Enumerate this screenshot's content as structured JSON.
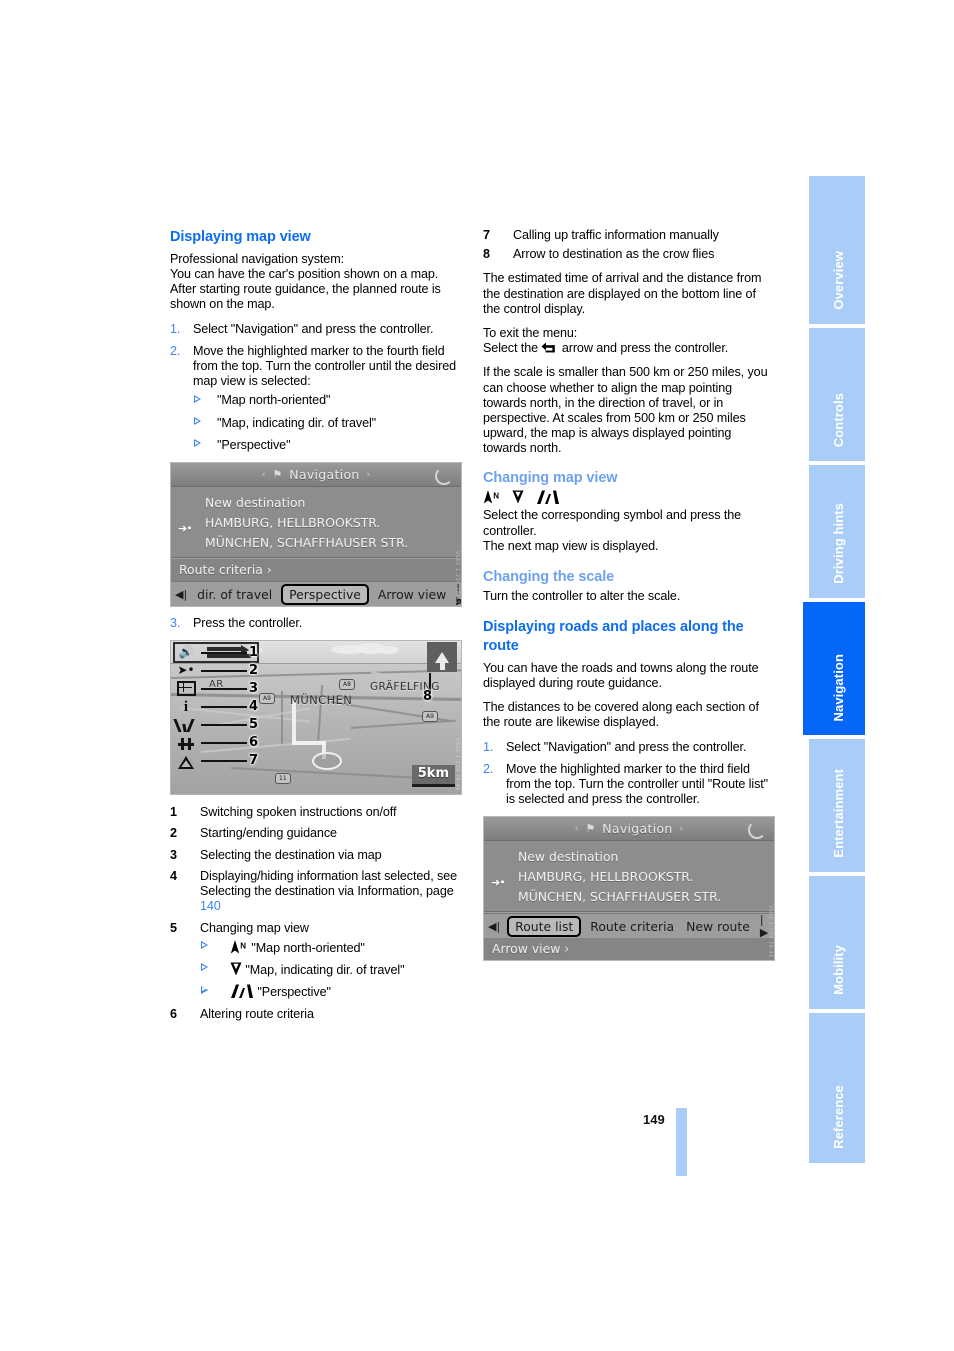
{
  "page": {
    "number": "149",
    "tabs": [
      {
        "label": "Overview",
        "active": false
      },
      {
        "label": "Controls",
        "active": false
      },
      {
        "label": "Driving hints",
        "active": false
      },
      {
        "label": "Navigation",
        "active": true
      },
      {
        "label": "Entertainment",
        "active": false
      },
      {
        "label": "Mobility",
        "active": false
      },
      {
        "label": "Reference",
        "active": false
      }
    ],
    "colors": {
      "heading_blue": "#0d6df0",
      "subheading_blue": "#6ea2ee",
      "tab_inactive": "#aacdf7",
      "tab_active": "#0566fa",
      "number_blue": "#3b86ef"
    }
  },
  "left": {
    "heading": "Displaying map view",
    "intro_line1": "Professional navigation system:",
    "intro_line2": "You can have the car's position shown on a map. After starting route guidance, the planned route is shown on the map.",
    "steps": [
      {
        "num": "1.",
        "text": "Select \"Navigation\" and press the controller."
      },
      {
        "num": "2.",
        "text": "Move the highlighted marker to the fourth field from the top. Turn the controller until the desired map view is selected:"
      }
    ],
    "map_view_options": [
      "\"Map north-oriented\"",
      "\"Map, indicating dir. of travel\"",
      "\"Perspective\""
    ],
    "step3": {
      "num": "3.",
      "text": "Press the controller."
    },
    "screenshot_nav": {
      "title": "Navigation",
      "title_left_arrow": "‹",
      "title_right_arrow": "›",
      "car_icon": "car-icon",
      "spinner_icon": "loading-spinner-icon",
      "rows": [
        {
          "label": "New destination",
          "marker": ""
        },
        {
          "label": "HAMBURG, HELLBROOKSTR.",
          "marker": "➜•"
        },
        {
          "label": "MÜNCHEN, SCHAFFHAUSER STR.",
          "marker": ""
        }
      ],
      "row_route_criteria": "Route criteria ›",
      "footer": {
        "left_arrow": "◀|",
        "left_item": "dir. of travel",
        "selected_item": "Perspective",
        "right_item": "Arrow view",
        "right_arrow": "|▶"
      }
    },
    "screenshot_map": {
      "icons": [
        {
          "n": "1",
          "name": "speaker-icon"
        },
        {
          "n": "2",
          "name": "guidance-arrow-icon"
        },
        {
          "n": "3",
          "name": "map-grid-icon"
        },
        {
          "n": "4",
          "name": "information-icon"
        },
        {
          "n": "5",
          "name": "map-view-icon"
        },
        {
          "n": "6",
          "name": "route-criteria-icon"
        },
        {
          "n": "7",
          "name": "traffic-warning-icon"
        }
      ],
      "callout_8": "8",
      "labels": [
        "MÜNCHEN",
        "GRÄFELFING"
      ],
      "scale": "5km"
    },
    "legend": [
      {
        "num": "1",
        "text": "Switching spoken instructions on/off"
      },
      {
        "num": "2",
        "text": "Starting/ending guidance"
      },
      {
        "num": "3",
        "text": "Selecting the destination via map"
      },
      {
        "num": "4",
        "text": "Displaying/hiding information last selected, see Selecting the destination via Information, page ",
        "page_ref": "140"
      },
      {
        "num": "5",
        "text": "Changing map view"
      },
      {
        "num": "6",
        "text": "Altering route criteria"
      }
    ],
    "legend5_options": [
      {
        "symbol": "map-north-oriented-icon",
        "text": "\"Map north-oriented\""
      },
      {
        "symbol": "map-direction-of-travel-icon",
        "text": "\"Map, indicating dir. of travel\""
      },
      {
        "symbol": "map-perspective-icon",
        "text": "\"Perspective\""
      }
    ]
  },
  "right": {
    "legend": [
      {
        "num": "7",
        "text": "Calling up traffic information manually"
      },
      {
        "num": "8",
        "text": "Arrow to destination as the crow flies"
      }
    ],
    "para_eta": "The estimated time of arrival and the distance from the destination are displayed on the bottom line of the control display.",
    "exit_line1": "To exit the menu:",
    "exit_line2_pre": "Select the ",
    "exit_line2_post": " arrow and press the controller.",
    "exit_icon": "back-arrow-icon",
    "para_scale": "If the scale is smaller than 500 km or 250 miles, you can choose whether to align the map pointing towards north, in the direction of travel, or in perspective. At scales from 500 km or 250 miles upward, the map is always displayed pointing towards north.",
    "changing_map_view": {
      "heading": "Changing map view",
      "symbols": [
        "map-north-oriented-icon",
        "map-direction-of-travel-icon",
        "map-perspective-icon"
      ],
      "line1": "Select the corresponding symbol and press the controller.",
      "line2": "The next map view is displayed."
    },
    "changing_the_scale": {
      "heading": "Changing the scale",
      "line1": "Turn the controller to alter the scale."
    },
    "roads_places": {
      "heading": "Displaying roads and places along the route",
      "para1": "You can have the roads and towns along the route displayed during route guidance.",
      "para2": "The distances to be covered along each section of the route are likewise displayed.",
      "steps": [
        {
          "num": "1.",
          "text": "Select \"Navigation\" and press the controller."
        },
        {
          "num": "2.",
          "text": "Move the highlighted marker to the third field from the top. Turn the controller until \"Route list\" is selected and press the controller."
        }
      ]
    },
    "screenshot_nav": {
      "title": "Navigation",
      "title_left_arrow": "‹",
      "title_right_arrow": "›",
      "car_icon": "car-icon",
      "spinner_icon": "loading-spinner-icon",
      "rows": [
        {
          "label": "New destination",
          "marker": ""
        },
        {
          "label": "HAMBURG, HELLBROOKSTR.",
          "marker": "➜•"
        },
        {
          "label": "MÜNCHEN, SCHAFFHAUSER STR.",
          "marker": ""
        }
      ],
      "footer": {
        "left_arrow": "◀|",
        "selected_item": "Route list",
        "item2": "Route criteria",
        "item3": "New route",
        "right_arrow": "|▶"
      },
      "row_arrow_view": "Arrow view ›"
    }
  }
}
